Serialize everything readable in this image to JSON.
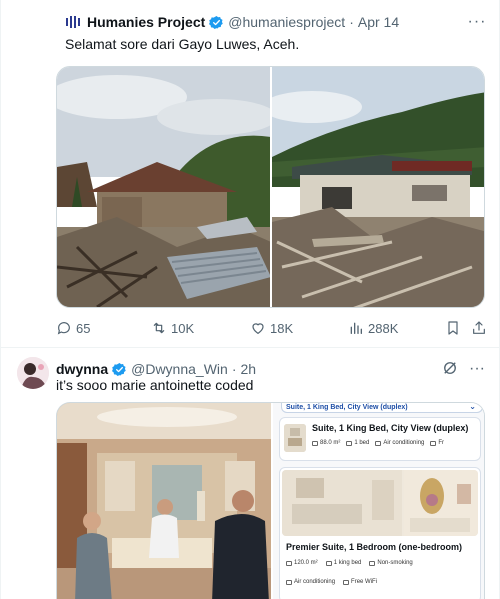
{
  "tweets": [
    {
      "author_name": "Humanies Project",
      "handle": "@humaniesproject",
      "time": "Apr 14",
      "text": "Selamat sore dari Gayo Luwes, Aceh.",
      "replies": "65",
      "reposts": "10K",
      "likes": "18K",
      "views": "288K"
    },
    {
      "author_name": "dwynna",
      "handle": "@Dwynna_Win",
      "time": "2h",
      "text": "it’s sooo marie antoinette coded"
    }
  ],
  "hotel": {
    "top_chip": "Suite, 1 King Bed, City View (duplex)",
    "card1": {
      "title": "Suite, 1 King Bed, City View (duplex)",
      "area": "88.0 m²",
      "bed": "1 bed",
      "feature": "Air conditioning",
      "extra": "Fr"
    },
    "card2": {
      "title": "Premier Suite, 1 Bedroom (one-bedroom)",
      "area": "120.0 m²",
      "bed": "1 king bed",
      "smoking": "Non-smoking",
      "ac": "Air conditioning",
      "wifi": "Free WiFi"
    }
  },
  "icons": {
    "brand_logo": "humanies-logo",
    "verified_color": "#1d9bf0",
    "action_color": "#536471"
  }
}
